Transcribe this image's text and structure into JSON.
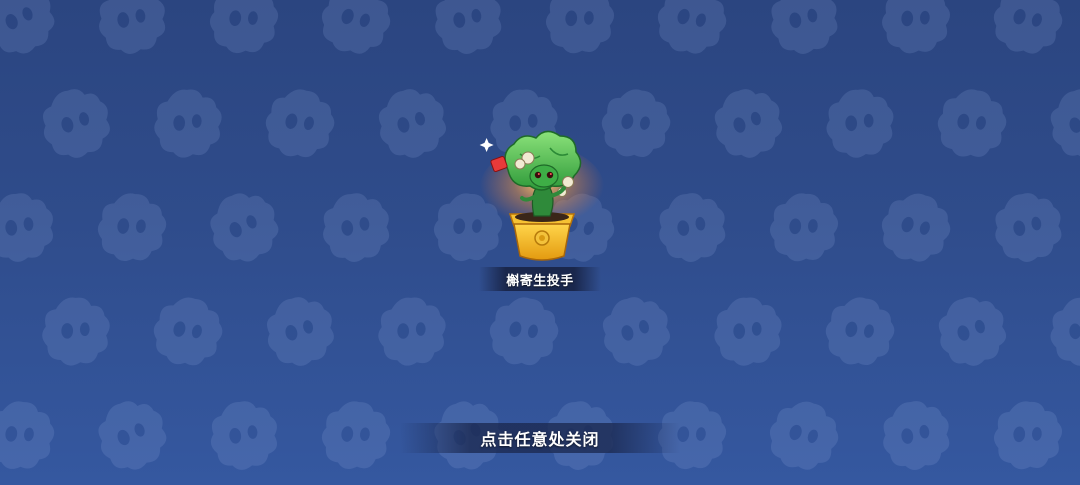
{
  "reward": {
    "item_name": "槲寄生投手",
    "icon": "mistletoe-pitcher-plant-icon"
  },
  "footer": {
    "close_hint": "点击任意处关闭"
  },
  "colors": {
    "background_top": "#2b4580",
    "background_bottom": "#3558a0",
    "pot": "#f2b21c",
    "leaf": "#4fc24a"
  }
}
